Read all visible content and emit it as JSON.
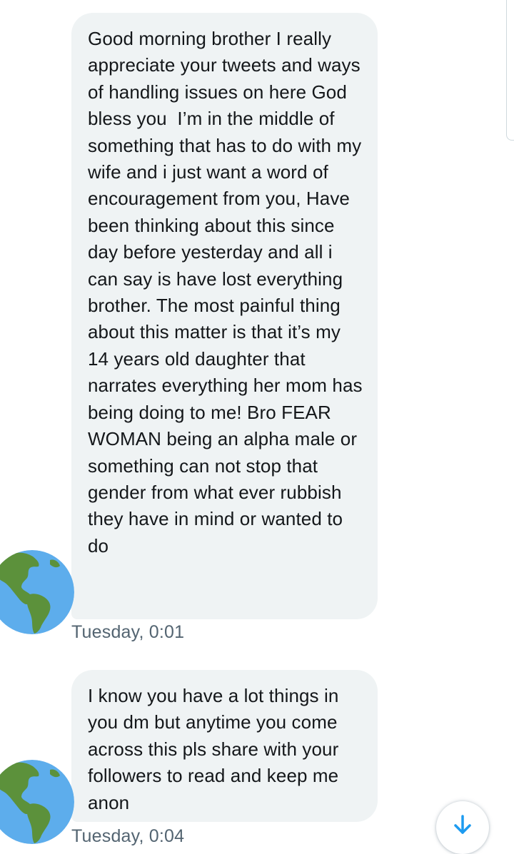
{
  "messages": [
    {
      "text": "Good morning brother I really appreciate your tweets and ways of handling issues on here God bless you  I’m in the middle of something that has to do with my wife and i just want a word of encouragement from you, Have been thinking about this since day before yesterday and all i can say is have lost everything brother. The most painful thing about this matter is that it’s my 14 years old daughter that narrates everything her mom has being doing to me! Bro FEAR WOMAN being an alpha male or something can not stop that gender from what ever rubbish they have in mind or wanted to do",
      "timestamp": "Tuesday, 0:01",
      "avatar_icon": "globe-americas-icon"
    },
    {
      "text": "I know you have a lot things in you dm but anytime you come across this pls share with your followers to read and keep me anon",
      "timestamp": "Tuesday, 0:04",
      "avatar_icon": "globe-americas-icon"
    }
  ],
  "scroll_down_icon": "arrow-down-icon",
  "colors": {
    "bubble_background": "#eff3f4",
    "timestamp_text": "#536471",
    "accent": "#1d9bf0",
    "globe_ocean": "#5dadec",
    "globe_land": "#5c913b"
  }
}
